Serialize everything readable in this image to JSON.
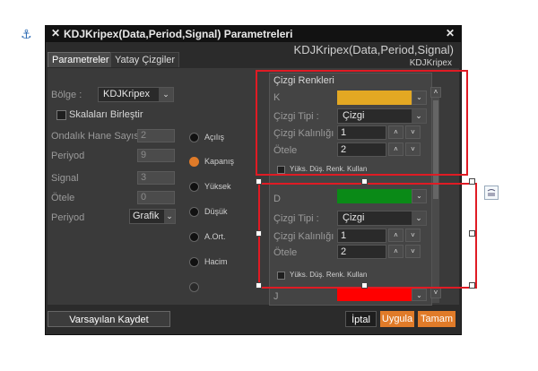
{
  "dialog": {
    "title": "KDJKripex(Data,Period,Signal) Parametreleri",
    "big_title": "KDJKripex(Data,Period,Signal)",
    "sub_title": "KDJKripex"
  },
  "tabs": [
    {
      "label": "Parametreler"
    },
    {
      "label": "Yatay Çizgiler"
    }
  ],
  "left": {
    "bolge_label": "Bölge :",
    "bolge_value": "KDJKripex",
    "birlestir_label": "Skalaları Birleştir",
    "ondalik_label": "Ondalık Hane Sayısı :",
    "ondalik_value": "2",
    "periyod_label": "Periyod",
    "periyod_value": "9",
    "signal_label": "Signal",
    "signal_value": "3",
    "otele_label": "Ötele",
    "otele_value": "0",
    "periyod2_label": "Periyod",
    "periyod2_value": "Grafik"
  },
  "radios": [
    {
      "label": "Açılış"
    },
    {
      "label": "Kapanış"
    },
    {
      "label": "Yüksek"
    },
    {
      "label": "Düşük"
    },
    {
      "label": "A.Ort."
    },
    {
      "label": "Hacim"
    }
  ],
  "right": {
    "section_title": "Çizgi Renkleri",
    "k": {
      "label": "K",
      "color": "#e3a823",
      "cizgi_tipi_label": "Çizgi Tipi :",
      "cizgi_tipi_value": "Çizgi",
      "kalinlik_label": "Çizgi Kalınlığı :",
      "kalinlik_value": "1",
      "otele_label": "Ötele",
      "otele_value": "2",
      "yuks_label": "Yüks. Düş. Renk. Kullan"
    },
    "d": {
      "label": "D",
      "color": "#0a8a17",
      "cizgi_tipi_label": "Çizgi Tipi :",
      "cizgi_tipi_value": "Çizgi",
      "kalinlik_label": "Çizgi Kalınlığı :",
      "kalinlik_value": "1",
      "otele_label": "Ötele",
      "otele_value": "2",
      "yuks_label": "Yüks. Düş. Renk. Kullan"
    },
    "j": {
      "label": "J",
      "color": "#ff0000"
    }
  },
  "buttons": {
    "save_default": "Varsayılan Kaydet",
    "cancel": "İptal",
    "apply": "Uygula",
    "ok": "Tamam"
  },
  "icons": {
    "anchor": "⚓",
    "close_left": "✕",
    "close_right": "✕",
    "chevron_down": "⌄",
    "spin_up": "˄",
    "spin_down": "˅"
  },
  "colors": {
    "accent": "#e07b29",
    "highlight": "#e01b24"
  }
}
